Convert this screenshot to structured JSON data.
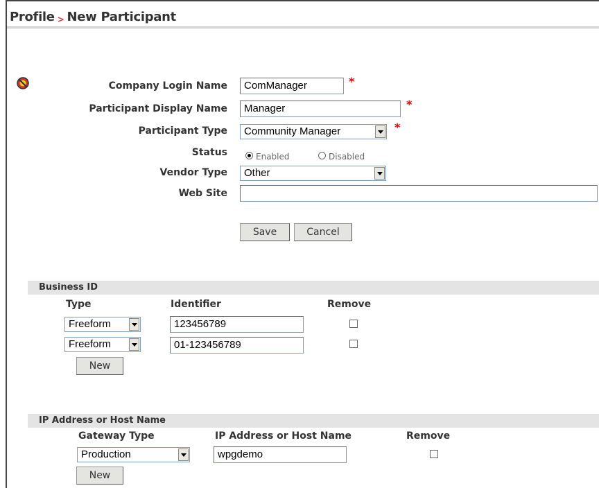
{
  "header": {
    "crumb_root": "Profile",
    "crumb_sep": ">",
    "crumb_page": "New Participant"
  },
  "form": {
    "login_label": "Company Login Name",
    "login_value": "ComManager",
    "display_label": "Participant Display Name",
    "display_value": "Manager",
    "type_label": "Participant Type",
    "type_value": "Community Manager",
    "status_label": "Status",
    "status_enabled": "Enabled",
    "status_disabled": "Disabled",
    "status_selected": "Enabled",
    "vendor_label": "Vendor Type",
    "vendor_value": "Other",
    "website_label": "Web Site",
    "website_value": "",
    "required_mark": "*",
    "save_label": "Save",
    "cancel_label": "Cancel"
  },
  "business_id": {
    "title": "Business ID",
    "col_type": "Type",
    "col_identifier": "Identifier",
    "col_remove": "Remove",
    "rows": [
      {
        "type": "Freeform",
        "identifier": "123456789",
        "remove": false
      },
      {
        "type": "Freeform",
        "identifier": "01-123456789",
        "remove": false
      }
    ],
    "new_label": "New"
  },
  "ip_hosts": {
    "title": "IP Address or Host Name",
    "col_gateway": "Gateway Type",
    "col_host": "IP Address or Host Name",
    "col_remove": "Remove",
    "rows": [
      {
        "gateway": "Production",
        "host": "wpgdemo",
        "remove": false
      }
    ],
    "new_label": "New"
  },
  "colors": {
    "required": "#e00000",
    "section_bg": "#e4e4e4"
  },
  "icons": {
    "status_badge": "no-entry-badge-icon"
  }
}
